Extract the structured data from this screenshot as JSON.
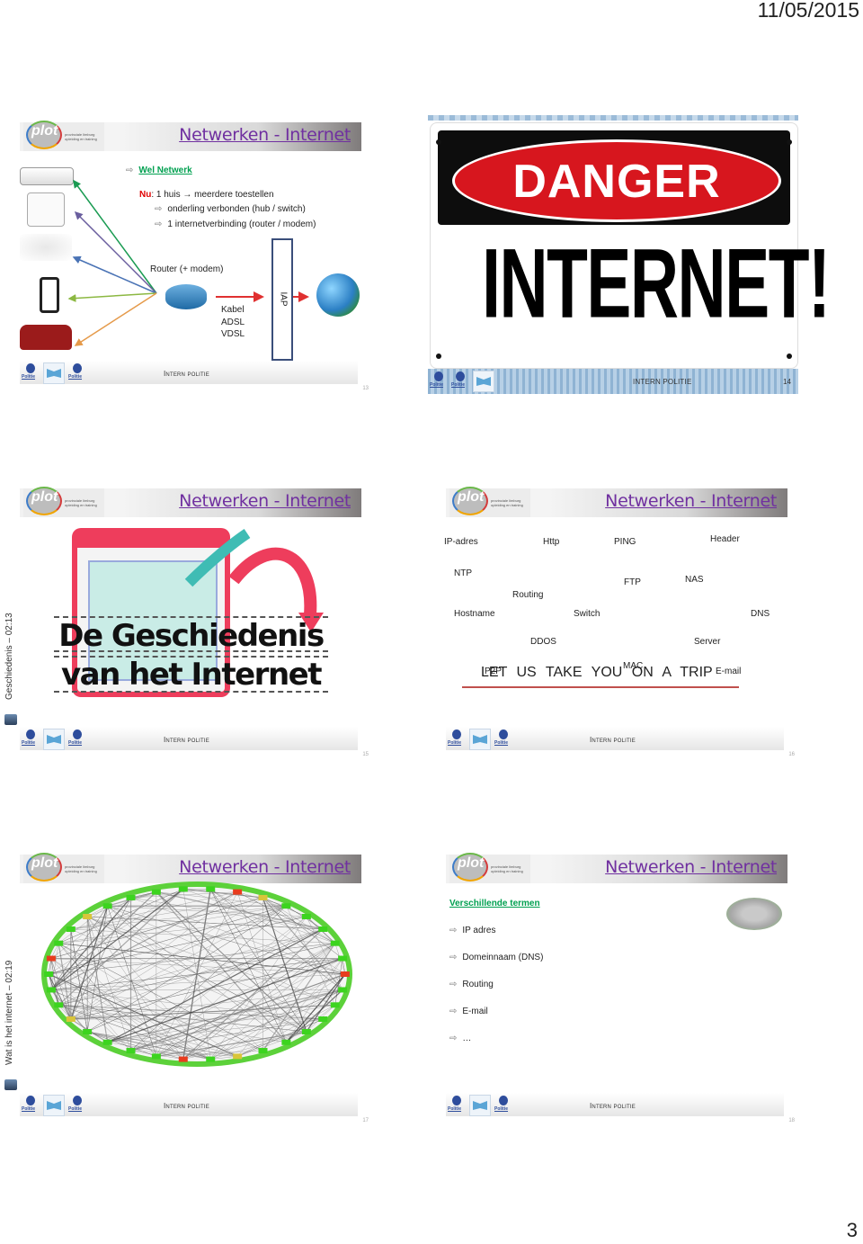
{
  "page": {
    "date": "11/05/2015",
    "number": "3"
  },
  "common": {
    "slide_title": "Netwerken - Internet",
    "footer_label": "Intern politie",
    "logo_word": "plot",
    "logo_sub": "provinciale limburg opleiding en training",
    "politie_badge": "Politie"
  },
  "slides": [
    {
      "number": "13",
      "heading": "Wel Netwerk",
      "nu_label": "Nu",
      "line1": ": 1 huis → meerdere toestellen",
      "bullets": [
        "onderling verbonden (hub / switch)",
        "1 internetverbinding (router / modem)"
      ],
      "router_label": "Router (+ modem)",
      "connection_types": [
        "Kabel",
        "ADSL",
        "VDSL"
      ],
      "iap_label": "IAP",
      "devices": [
        "game-console",
        "desktop-user",
        "laptop-user",
        "smartphone",
        "sofa-user"
      ],
      "arrow_colors": [
        "#1a9b52",
        "#6a5e9e",
        "#4a73b5",
        "#8cb842",
        "#e59a4a"
      ],
      "link_color": "#e03030"
    },
    {
      "number": "14",
      "sign_top": "DANGER",
      "sign_main": "INTERNET!",
      "footer_label": "INTERN POLITIE",
      "colors": {
        "danger_red": "#d7161e",
        "band": "#0d0d0d"
      }
    },
    {
      "number": "15",
      "side_caption": "Geschiedenis – 02:13",
      "image_line1": "De Geschiedenis",
      "image_line2": "van het Internet"
    },
    {
      "number": "16",
      "terms": [
        "IP-adres",
        "Http",
        "PING",
        "Header",
        "NTP",
        "FTP",
        "NAS",
        "Routing",
        "Hostname",
        "Switch",
        "DNS",
        "DDOS",
        "Server",
        "MAC",
        "P2P",
        "E-mail"
      ],
      "trip_text": "LET  US  TAKE  YOU  ON  A  TRIP"
    },
    {
      "number": "17",
      "side_caption": "Wat is het internet – 02:19",
      "image_alt": "network-graph"
    },
    {
      "number": "18",
      "heading": "Verschillende termen",
      "items": [
        "IP adres",
        "Domeinnaam (DNS)",
        "Routing",
        "E-mail",
        "…"
      ]
    }
  ],
  "icons": {
    "bullet": "⇨",
    "video": "video-clip-icon"
  }
}
